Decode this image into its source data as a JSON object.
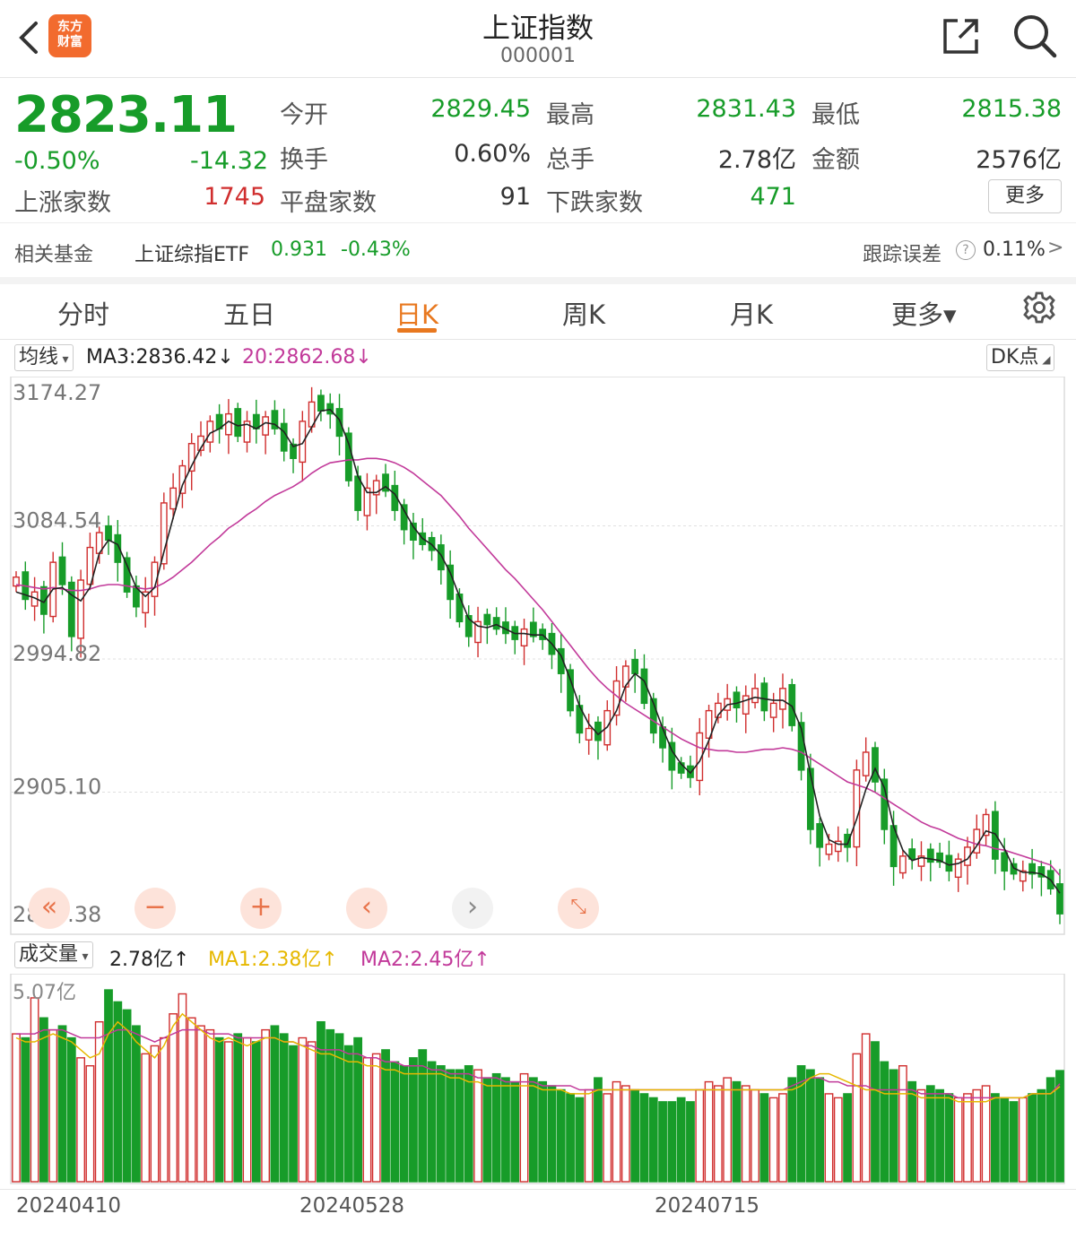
{
  "header": {
    "logo_line1": "东方",
    "logo_line2": "财富",
    "title": "上证指数",
    "code": "000001"
  },
  "quote": {
    "price": "2823.11",
    "change_pct": "-0.50%",
    "change": "-14.32",
    "open_label": "今开",
    "open": "2829.45",
    "high_label": "最高",
    "high": "2831.43",
    "low_label": "最低",
    "low": "2815.38",
    "turnover_label": "换手",
    "turnover": "0.60%",
    "volume_label": "总手",
    "volume": "2.78亿",
    "amount_label": "金额",
    "amount": "2576亿",
    "up_label": "上涨家数",
    "up": "1745",
    "flat_label": "平盘家数",
    "flat": "91",
    "down_label": "下跌家数",
    "down": "471",
    "more_label": "更多"
  },
  "fund": {
    "label": "相关基金",
    "name": "上证综指ETF",
    "price": "0.931",
    "change": "-0.43%",
    "track_label": "跟踪误差",
    "track_help": "?",
    "track_value": "0.11%",
    "track_arrow": ">"
  },
  "tabs": {
    "t1": "分时",
    "t2": "五日",
    "t3": "日K",
    "t4": "周K",
    "t5": "月K",
    "t6": "更多▾"
  },
  "indicators": {
    "ma_select": "均线",
    "ma3": "MA3:2836.42↓",
    "ma20": "20:2862.68↓",
    "dk": "DK点",
    "vol_select": "成交量",
    "vol": "2.78亿↑",
    "vol_ma1": "MA1:2.38亿↑",
    "vol_ma2": "MA2:2.45亿↑"
  },
  "colors": {
    "up": "#d02e2e",
    "down": "#179c29",
    "ma_short": "#222222",
    "ma_long": "#c23a9a",
    "vol_ma1": "#e6b800",
    "vol_ma2": "#c23a9a"
  },
  "chart_data": {
    "type": "candlestick",
    "y_ticks": [
      "3174.27",
      "3084.54",
      "2994.82",
      "2905.10",
      "2815.38"
    ],
    "ylim": [
      2815.38,
      3174.27
    ],
    "x_labels": [
      "20240410",
      "20240528",
      "20240715"
    ],
    "volume_max_label": "5.07亿",
    "volume_ylim": [
      0,
      5.07
    ],
    "close": [
      3050,
      3035,
      3040,
      3025,
      3060,
      3045,
      3010,
      3048,
      3070,
      3080,
      3075,
      3060,
      3040,
      3030,
      3040,
      3060,
      3100,
      3110,
      3125,
      3140,
      3145,
      3155,
      3150,
      3160,
      3145,
      3155,
      3150,
      3158,
      3150,
      3135,
      3130,
      3155,
      3168,
      3162,
      3160,
      3145,
      3115,
      3095,
      3110,
      3115,
      3108,
      3095,
      3082,
      3075,
      3072,
      3068,
      3055,
      3035,
      3020,
      3010,
      3020,
      3018,
      3015,
      3012,
      3008,
      3015,
      3010,
      3008,
      2998,
      2985,
      2960,
      2945,
      2948,
      2940,
      2960,
      2980,
      2990,
      2985,
      2965,
      2945,
      2935,
      2920,
      2918,
      2915,
      2945,
      2960,
      2965,
      2968,
      2962,
      2970,
      2975,
      2960,
      2965,
      2975,
      2950,
      2920,
      2880,
      2868,
      2870,
      2872,
      2868,
      2920,
      2932,
      2912,
      2880,
      2855,
      2862,
      2860,
      2862,
      2858,
      2858,
      2852,
      2860,
      2868,
      2880,
      2890,
      2860,
      2852,
      2850,
      2852,
      2850,
      2848,
      2840,
      2823.11
    ],
    "up": [
      true,
      false,
      true,
      false,
      true,
      false,
      false,
      true,
      true,
      true,
      false,
      false,
      false,
      false,
      true,
      true,
      true,
      true,
      true,
      true,
      true,
      true,
      false,
      true,
      false,
      true,
      false,
      true,
      false,
      false,
      false,
      true,
      true,
      false,
      false,
      false,
      false,
      false,
      true,
      true,
      false,
      false,
      false,
      false,
      false,
      false,
      false,
      false,
      false,
      false,
      true,
      false,
      false,
      false,
      false,
      true,
      false,
      false,
      false,
      false,
      false,
      false,
      true,
      false,
      true,
      true,
      true,
      false,
      false,
      false,
      false,
      false,
      false,
      false,
      true,
      true,
      true,
      true,
      false,
      true,
      true,
      false,
      true,
      true,
      false,
      false,
      false,
      false,
      true,
      true,
      false,
      true,
      true,
      false,
      false,
      false,
      true,
      false,
      true,
      false,
      false,
      false,
      true,
      true,
      true,
      true,
      false,
      false,
      false,
      true,
      false,
      false,
      false,
      false
    ],
    "ma_short": [
      3040,
      3038,
      3036,
      3033,
      3042,
      3043,
      3038,
      3034,
      3043,
      3066,
      3075,
      3072,
      3058,
      3043,
      3037,
      3043,
      3067,
      3090,
      3112,
      3125,
      3137,
      3147,
      3150,
      3155,
      3152,
      3153,
      3150,
      3154,
      3153,
      3148,
      3138,
      3140,
      3151,
      3162,
      3163,
      3156,
      3140,
      3118,
      3107,
      3107,
      3111,
      3106,
      3095,
      3084,
      3076,
      3072,
      3065,
      3053,
      3037,
      3022,
      3017,
      3016,
      3018,
      3015,
      3012,
      3012,
      3011,
      3011,
      3005,
      2997,
      2981,
      2963,
      2951,
      2944,
      2949,
      2960,
      2977,
      2985,
      2980,
      2965,
      2948,
      2933,
      2924,
      2918,
      2926,
      2940,
      2957,
      2964,
      2965,
      2967,
      2969,
      2968,
      2967,
      2967,
      2963,
      2948,
      2917,
      2889,
      2873,
      2870,
      2870,
      2887,
      2907,
      2921,
      2908,
      2882,
      2866,
      2859,
      2861,
      2860,
      2859,
      2856,
      2857,
      2860,
      2869,
      2879,
      2877,
      2867,
      2854,
      2851,
      2851,
      2850,
      2846,
      2837
    ],
    "ma_long": [
      3045,
      3044,
      3043,
      3042,
      3043,
      3042,
      3041,
      3041,
      3042,
      3044,
      3045,
      3045,
      3044,
      3043,
      3042,
      3043,
      3046,
      3050,
      3055,
      3060,
      3066,
      3072,
      3077,
      3083,
      3087,
      3092,
      3096,
      3101,
      3105,
      3108,
      3111,
      3115,
      3120,
      3124,
      3127,
      3128,
      3129,
      3129,
      3130,
      3130,
      3129,
      3127,
      3124,
      3120,
      3115,
      3110,
      3105,
      3098,
      3091,
      3083,
      3076,
      3069,
      3062,
      3055,
      3049,
      3042,
      3035,
      3028,
      3020,
      3012,
      3004,
      2996,
      2988,
      2981,
      2975,
      2970,
      2965,
      2961,
      2957,
      2953,
      2949,
      2945,
      2941,
      2938,
      2935,
      2934,
      2933,
      2933,
      2932,
      2932,
      2933,
      2934,
      2934,
      2935,
      2934,
      2932,
      2928,
      2924,
      2920,
      2916,
      2912,
      2910,
      2908,
      2905,
      2901,
      2897,
      2893,
      2889,
      2885,
      2882,
      2880,
      2877,
      2874,
      2872,
      2870,
      2869,
      2867,
      2866,
      2864,
      2862,
      2860,
      2858,
      2856,
      2849
    ],
    "volume": [
      3.7,
      3.6,
      4.6,
      4.1,
      3.8,
      3.9,
      3.6,
      3.1,
      2.9,
      4.0,
      4.8,
      4.5,
      4.3,
      3.9,
      3.2,
      3.4,
      3.6,
      4.2,
      4.7,
      4.1,
      3.9,
      3.8,
      3.6,
      3.5,
      3.7,
      3.6,
      3.5,
      3.8,
      3.9,
      3.7,
      3.4,
      3.6,
      3.5,
      4.0,
      3.8,
      3.7,
      3.4,
      3.6,
      3.1,
      3.2,
      3.3,
      3.0,
      2.9,
      3.1,
      3.3,
      3.0,
      2.9,
      2.8,
      2.8,
      2.9,
      2.8,
      2.6,
      2.7,
      2.6,
      2.5,
      2.7,
      2.6,
      2.5,
      2.4,
      2.3,
      2.2,
      2.1,
      2.3,
      2.6,
      2.2,
      2.5,
      2.4,
      2.3,
      2.2,
      2.1,
      2.0,
      2.0,
      2.1,
      2.0,
      2.3,
      2.5,
      2.4,
      2.6,
      2.5,
      2.4,
      2.3,
      2.2,
      2.1,
      2.2,
      2.6,
      2.9,
      2.8,
      2.6,
      2.2,
      2.1,
      2.2,
      3.2,
      3.7,
      3.5,
      3.0,
      2.8,
      2.9,
      2.5,
      2.3,
      2.4,
      2.3,
      2.2,
      2.1,
      2.2,
      2.3,
      2.4,
      2.2,
      2.1,
      2.0,
      2.1,
      2.2,
      2.3,
      2.6,
      2.78
    ],
    "vol_ma1": [
      3.6,
      3.5,
      3.5,
      3.6,
      3.7,
      3.6,
      3.5,
      3.3,
      3.1,
      3.2,
      3.7,
      4.0,
      3.8,
      3.5,
      3.3,
      3.1,
      3.4,
      3.9,
      4.2,
      4.0,
      3.8,
      3.6,
      3.5,
      3.6,
      3.5,
      3.4,
      3.5,
      3.6,
      3.6,
      3.5,
      3.5,
      3.4,
      3.3,
      3.2,
      3.2,
      3.1,
      3.0,
      3.0,
      2.9,
      2.9,
      2.8,
      2.8,
      2.7,
      2.7,
      2.7,
      2.7,
      2.7,
      2.6,
      2.6,
      2.5,
      2.5,
      2.4,
      2.4,
      2.4,
      2.4,
      2.4,
      2.4,
      2.3,
      2.3,
      2.3,
      2.2,
      2.2,
      2.2,
      2.3,
      2.3,
      2.3,
      2.3,
      2.3,
      2.3,
      2.3,
      2.3,
      2.3,
      2.3,
      2.3,
      2.3,
      2.3,
      2.3,
      2.3,
      2.3,
      2.3,
      2.3,
      2.3,
      2.3,
      2.3,
      2.3,
      2.4,
      2.6,
      2.7,
      2.7,
      2.6,
      2.5,
      2.4,
      2.3,
      2.3,
      2.2,
      2.2,
      2.2,
      2.2,
      2.1,
      2.1,
      2.1,
      2.1,
      2.0,
      2.0,
      2.0,
      2.0,
      2.1,
      2.1,
      2.1,
      2.1,
      2.2,
      2.2,
      2.2,
      2.38
    ],
    "vol_ma2": [
      3.7,
      3.7,
      3.7,
      3.8,
      3.8,
      3.8,
      3.7,
      3.6,
      3.6,
      3.6,
      3.7,
      3.8,
      3.8,
      3.7,
      3.6,
      3.5,
      3.6,
      3.7,
      3.8,
      3.8,
      3.8,
      3.7,
      3.7,
      3.7,
      3.6,
      3.6,
      3.6,
      3.6,
      3.6,
      3.5,
      3.5,
      3.4,
      3.4,
      3.3,
      3.3,
      3.3,
      3.2,
      3.2,
      3.1,
      3.1,
      3.0,
      3.0,
      2.9,
      2.9,
      2.9,
      2.8,
      2.8,
      2.7,
      2.7,
      2.7,
      2.6,
      2.6,
      2.6,
      2.5,
      2.5,
      2.5,
      2.5,
      2.4,
      2.4,
      2.4,
      2.4,
      2.3,
      2.3,
      2.3,
      2.3,
      2.3,
      2.3,
      2.3,
      2.3,
      2.3,
      2.3,
      2.3,
      2.3,
      2.3,
      2.3,
      2.3,
      2.3,
      2.3,
      2.3,
      2.3,
      2.3,
      2.3,
      2.3,
      2.3,
      2.4,
      2.5,
      2.6,
      2.6,
      2.5,
      2.5,
      2.4,
      2.4,
      2.4,
      2.3,
      2.3,
      2.3,
      2.3,
      2.3,
      2.2,
      2.2,
      2.2,
      2.2,
      2.1,
      2.1,
      2.1,
      2.1,
      2.1,
      2.1,
      2.1,
      2.1,
      2.2,
      2.2,
      2.2,
      2.45
    ]
  }
}
